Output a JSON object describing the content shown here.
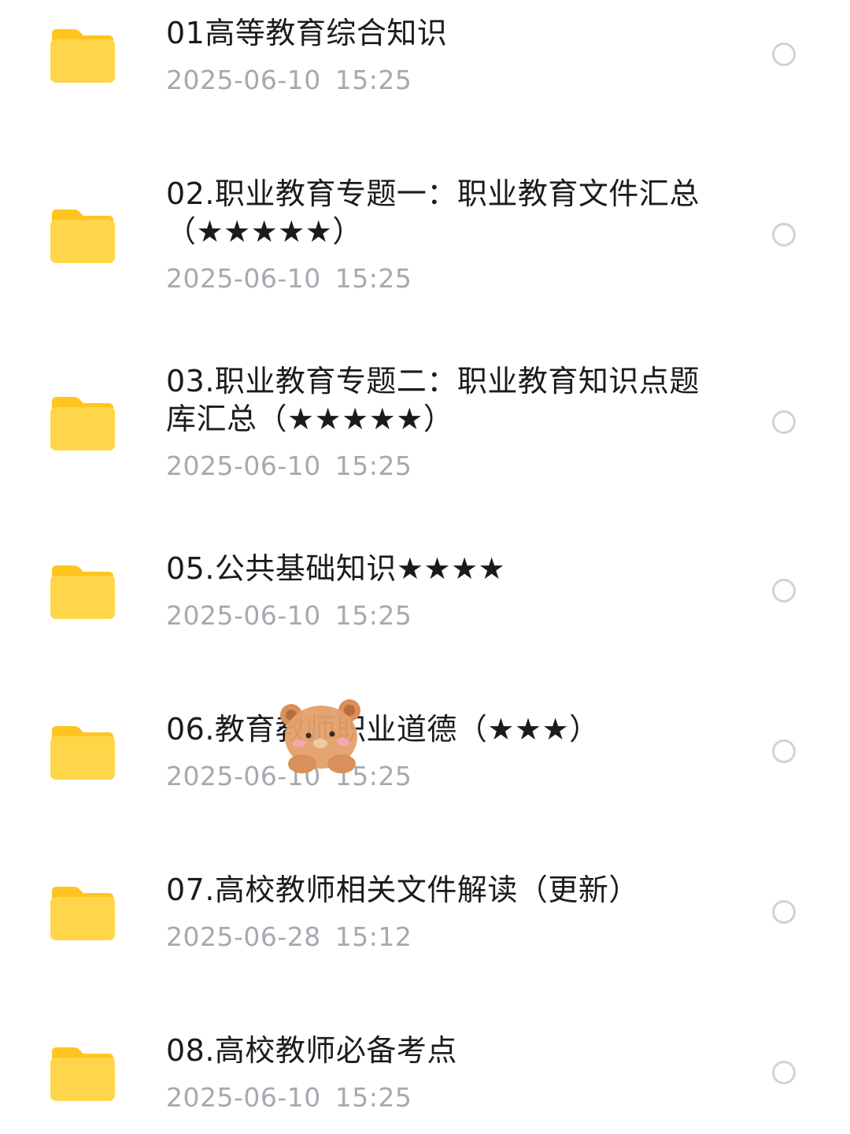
{
  "files": [
    {
      "name": "01高等教育综合知识",
      "date": "2025-06-10",
      "time": "15:25"
    },
    {
      "name": "02.职业教育专题一：职业教育文件汇总（★★★★★）",
      "date": "2025-06-10",
      "time": "15:25"
    },
    {
      "name": "03.职业教育专题二：职业教育知识点题库汇总（★★★★★）",
      "date": "2025-06-10",
      "time": "15:25"
    },
    {
      "name": "05.公共基础知识★★★★",
      "date": "2025-06-10",
      "time": "15:25"
    },
    {
      "name": "06.教育教师职业道德（★★★）",
      "date": "2025-06-10",
      "time": "15:25"
    },
    {
      "name": "07.高校教师相关文件解读（更新）",
      "date": "2025-06-28",
      "time": "15:12"
    },
    {
      "name": "08.高校教师必备考点",
      "date": "2025-06-10",
      "time": "15:25"
    }
  ],
  "icons": {
    "folder": "folder-icon",
    "select": "radio-circle-icon",
    "sticker": "bear-sticker"
  },
  "colors": {
    "folder_body": "#FFD54A",
    "folder_tab": "#FFC41F",
    "text_primary": "#1b1b1f",
    "text_secondary": "#a8a8b0",
    "radio_border": "#d2d2d6"
  }
}
